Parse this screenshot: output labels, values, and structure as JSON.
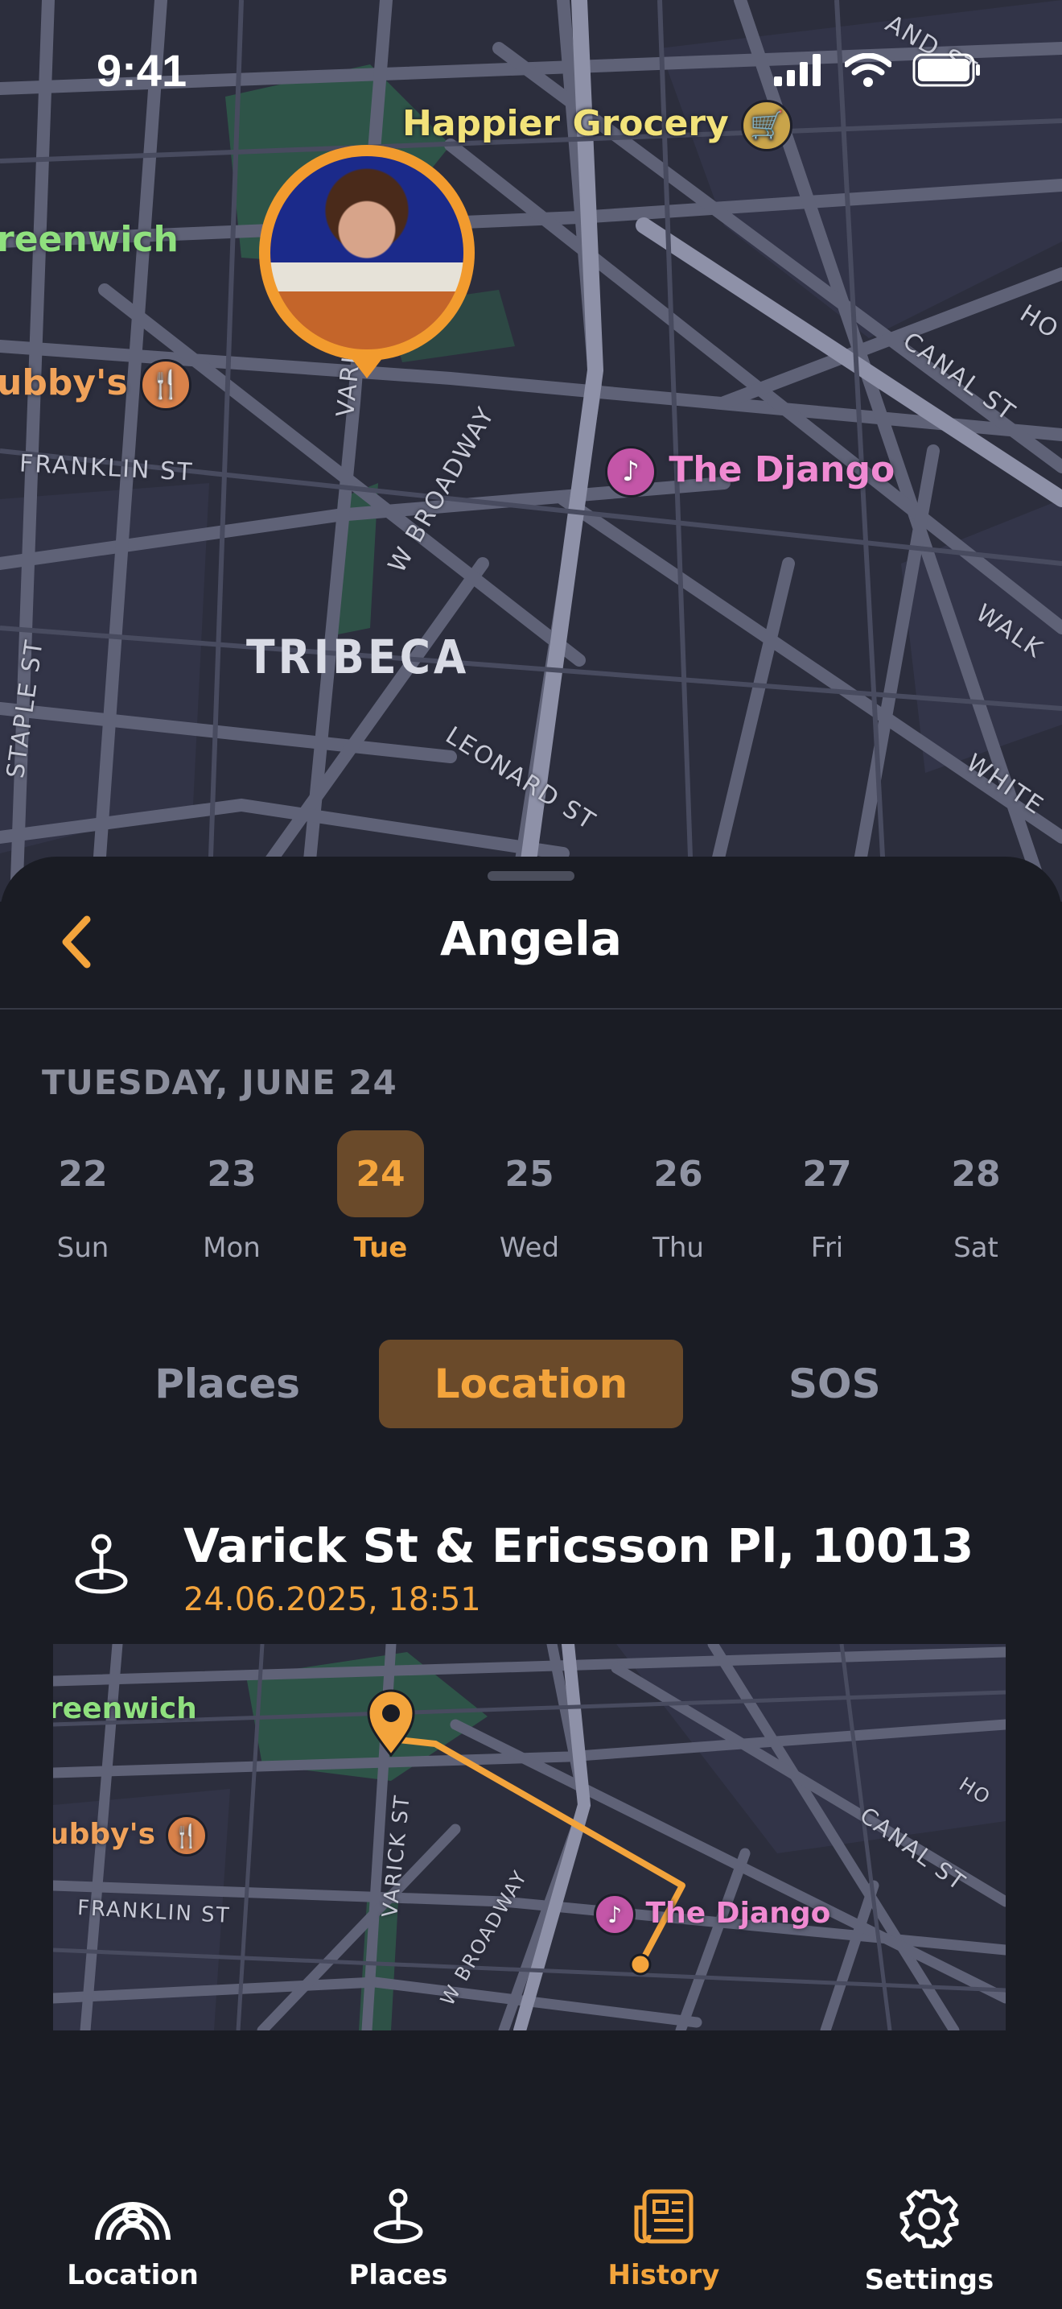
{
  "status_bar": {
    "time": "9:41"
  },
  "map": {
    "pois": {
      "grocery": "Happier Grocery",
      "greenwich": "reenwich",
      "restaurant": "ubby's",
      "music": "The Django"
    },
    "streets": {
      "franklin": "FRANKLIN ST",
      "varick": "VARI",
      "broadway": "W BROADWAY",
      "canal": "CANAL ST",
      "leonard": "LEONARD ST",
      "staple": "STAPLE ST",
      "walker": "WALK",
      "white": "WHITE",
      "nd": "AND ST",
      "ho": "HO"
    },
    "district": "TRIBECA"
  },
  "sheet": {
    "title": "Angela",
    "date_heading": "TUESDAY, JUNE 24",
    "week": [
      {
        "num": "22",
        "dow": "Sun"
      },
      {
        "num": "23",
        "dow": "Mon"
      },
      {
        "num": "24",
        "dow": "Tue",
        "selected": true
      },
      {
        "num": "25",
        "dow": "Wed"
      },
      {
        "num": "26",
        "dow": "Thu"
      },
      {
        "num": "27",
        "dow": "Fri"
      },
      {
        "num": "28",
        "dow": "Sat"
      }
    ],
    "segments": {
      "places": "Places",
      "location": "Location",
      "sos": "SOS"
    },
    "active_segment": "Location",
    "entry": {
      "icon": "pin-icon",
      "address": "Varick St & Ericsson Pl, 10013",
      "timestamp": "24.06.2025, 18:51"
    },
    "mini_map": {
      "greenwich": "reenwich",
      "restaurant": "ubby's",
      "music": "The Django",
      "franklin": "FRANKLIN ST",
      "varick": "VARICK ST",
      "broadway": "W BROADWAY",
      "canal": "CANAL ST",
      "ho": "HO"
    }
  },
  "tab_bar": {
    "tabs": [
      {
        "label": "Location",
        "icon": "location-person-icon"
      },
      {
        "label": "Places",
        "icon": "pin-icon"
      },
      {
        "label": "History",
        "icon": "history-icon",
        "active": true
      },
      {
        "label": "Settings",
        "icon": "gear-icon"
      }
    ]
  },
  "colors": {
    "accent": "#f3a43c",
    "background": "#1a1c24",
    "map": "#2c2e3d"
  }
}
